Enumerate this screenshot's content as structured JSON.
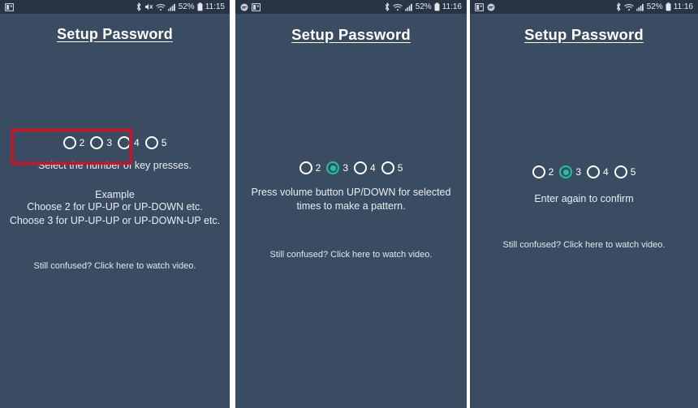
{
  "screens": [
    {
      "id": "screen-select-count",
      "statusbar": {
        "left_icons": [
          "photo-icon"
        ],
        "right_icons": [
          "bluetooth-icon",
          "mute-icon",
          "wifi-icon",
          "signal-icon"
        ],
        "battery_percent": "52%",
        "battery_icon": "battery-icon",
        "time": "11:15"
      },
      "title": "Setup Password",
      "radios": [
        {
          "label": "2",
          "selected": false
        },
        {
          "label": "3",
          "selected": false
        },
        {
          "label": "4",
          "selected": false
        },
        {
          "label": "5",
          "selected": false
        }
      ],
      "highlight": true,
      "highlight_color": "#c0182c",
      "caption": "Select the number of key presses.",
      "example_head": "Example",
      "example_lines": [
        "Choose 2 for UP-UP or UP-DOWN etc.",
        "Choose 3 for UP-UP-UP or UP-DOWN-UP etc."
      ],
      "link": "Still confused? Click here to watch video."
    },
    {
      "id": "screen-enter-pattern",
      "statusbar": {
        "left_icons": [
          "chat-icon",
          "photo-icon"
        ],
        "right_icons": [
          "bluetooth-icon",
          "wifi-icon",
          "signal-icon"
        ],
        "battery_percent": "52%",
        "battery_icon": "battery-icon",
        "time": "11:16"
      },
      "title": "Setup Password",
      "radios": [
        {
          "label": "2",
          "selected": false
        },
        {
          "label": "3",
          "selected": true
        },
        {
          "label": "4",
          "selected": false
        },
        {
          "label": "5",
          "selected": false
        }
      ],
      "highlight": false,
      "caption": "Press volume button UP/DOWN for selected times to make a pattern.",
      "link": "Still confused? Click here to watch video."
    },
    {
      "id": "screen-confirm-pattern",
      "statusbar": {
        "left_icons": [
          "photo-icon",
          "chat-icon"
        ],
        "right_icons": [
          "bluetooth-icon",
          "wifi-icon",
          "signal-icon"
        ],
        "battery_percent": "52%",
        "battery_icon": "battery-icon",
        "time": "11:16"
      },
      "title": "Setup Password",
      "radios": [
        {
          "label": "2",
          "selected": false
        },
        {
          "label": "3",
          "selected": true
        },
        {
          "label": "4",
          "selected": false
        },
        {
          "label": "5",
          "selected": false
        }
      ],
      "highlight": false,
      "caption": "Enter again to confirm",
      "link": "Still confused? Click here to watch video."
    }
  ],
  "theme": {
    "background": "#3a4c61",
    "statusbar_background": "#273445",
    "accent_selected": "#1fc49c",
    "text": "#e9edf1",
    "highlight": "#c0182c"
  }
}
